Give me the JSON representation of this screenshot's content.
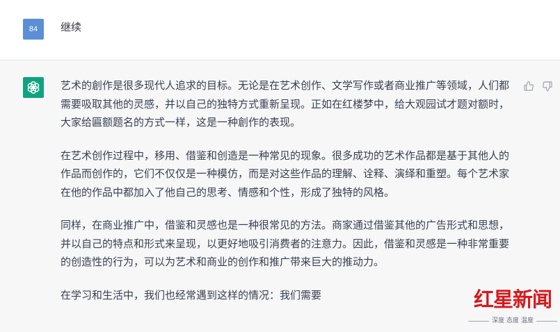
{
  "user_message": {
    "avatar_label": "84",
    "text": "继续"
  },
  "assistant_message": {
    "paragraphs": [
      "艺术的創作是很多现代人追求的目标。无论是在艺术创作、文学写作或者商业推广等领域，人们都需要吸取其他的灵感，并以自己的独特方式重新呈现。正如在红楼梦中，给大观园试才题对额时，大家给匾额题名的方式一样，这是一种創作的表现。",
      "在艺术创作过程中，移用、借鉴和创造是一种常见的现象。很多成功的艺术作品都是基于其他人的作品而创作的，它们不仅仅是一种模仿，而是对这些作品的理解、诠释、演绎和重塑。每个艺术家在他的作品中都加入了他自己的思考、情感和个性，形成了独特的风格。",
      "同样，在商业推广中，借鉴和灵感也是一种很常见的方法。商家通过借鉴其他的广告形式和思想，并以自己的特点和形式来呈现，以更好地吸引消费者的注意力。因此，借鉴和灵感是一种非常重要的创造性的行为，可以为艺术和商业的创作和推广带来巨大的推动力。",
      "在学习和生活中，我们也经常遇到这样的情况：我们需要"
    ]
  },
  "watermark": {
    "title": "红星新闻",
    "subtitle": "深度 态度 温度"
  },
  "icons": [
    "chatgpt-logo-icon",
    "thumbs-up-icon",
    "thumbs-down-icon"
  ],
  "colors": {
    "user_avatar_bg": "#5a8fd6",
    "bot_avatar_bg": "#10a37f",
    "assistant_bg": "#f7f7f8",
    "watermark_red": "#d7191c"
  }
}
